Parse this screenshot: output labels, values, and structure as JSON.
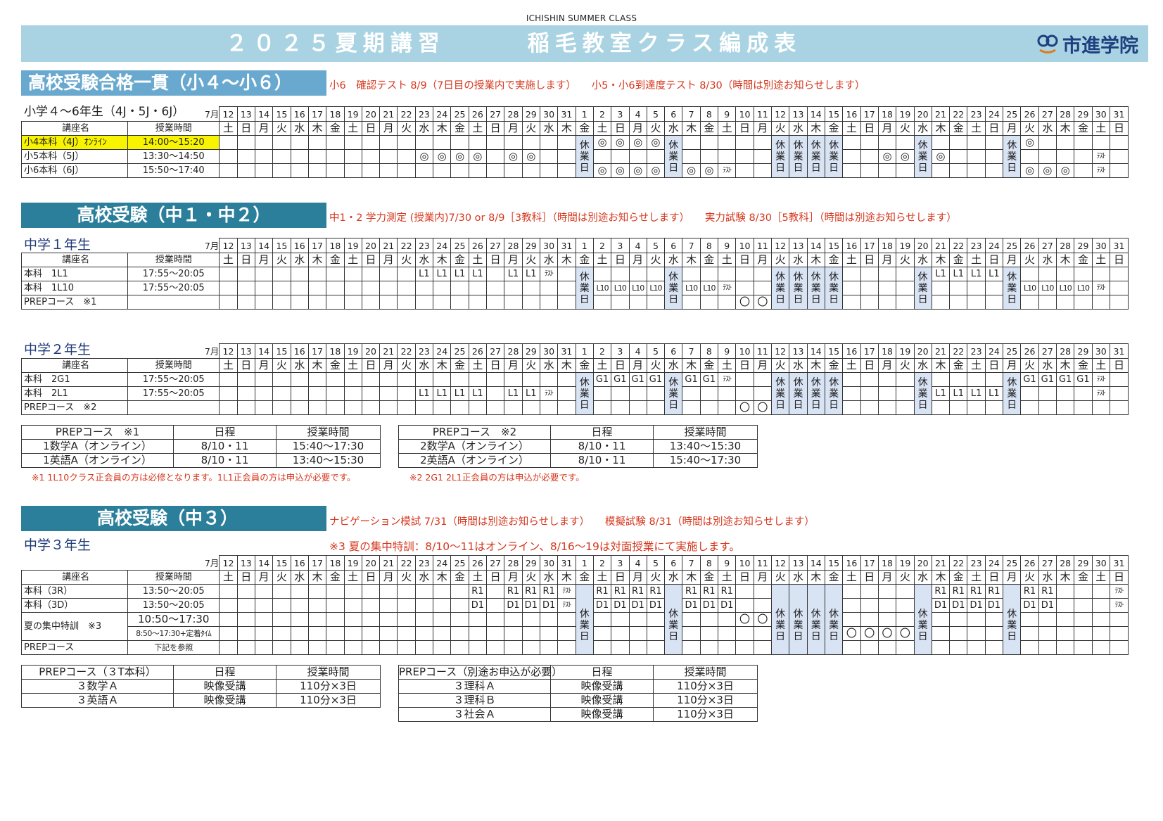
{
  "header": {
    "subtitle": "ICHISHIN SUMMER CLASS",
    "title": "２０２５夏期講習　　　稲毛教室クラス編成表",
    "logo_text": "市進学院",
    "banner_color": "#a9d3e2"
  },
  "colors": {
    "heading": "#2b7f9a",
    "heading_light": "#6aa9cf",
    "note": "#d5371e",
    "holiday": "#d8e3f4",
    "highlight": "#f8f400"
  },
  "calendar": {
    "month_label": "7月",
    "days": [
      "12",
      "13",
      "14",
      "15",
      "16",
      "17",
      "18",
      "19",
      "20",
      "21",
      "22",
      "23",
      "24",
      "25",
      "26",
      "27",
      "28",
      "29",
      "30",
      "31",
      "1",
      "2",
      "3",
      "4",
      "5",
      "6",
      "7",
      "8",
      "9",
      "10",
      "11",
      "12",
      "13",
      "14",
      "15",
      "16",
      "17",
      "18",
      "19",
      "20",
      "21",
      "22",
      "23",
      "24",
      "25",
      "26",
      "27",
      "28",
      "29",
      "30",
      "31"
    ],
    "weekdays": [
      "土",
      "日",
      "月",
      "火",
      "水",
      "木",
      "金",
      "土",
      "日",
      "月",
      "火",
      "水",
      "木",
      "金",
      "土",
      "日",
      "月",
      "火",
      "水",
      "木",
      "金",
      "土",
      "日",
      "月",
      "火",
      "水",
      "木",
      "金",
      "土",
      "日",
      "月",
      "火",
      "水",
      "木",
      "金",
      "土",
      "日",
      "月",
      "火",
      "水",
      "木",
      "金",
      "土",
      "日",
      "月",
      "火",
      "水",
      "木",
      "金",
      "土",
      "日"
    ],
    "holiday_text": "休業日"
  },
  "s1": {
    "heading": "高校受験合格一貫（小４～小６）",
    "note": "小6　確認テスト 8/9（7日目の授業内で実施します）　　小5・小6到達度テスト 8/30（時間は別途お知らせします）",
    "sub": "小学４～6年生（4J・5J・6J）",
    "col_name": "講座名",
    "col_time": "授業時間",
    "holidays": [
      20,
      25
    ],
    "rows": [
      {
        "name": "小4本科（4J）ｵﾝﾗｲﾝ",
        "time": "14:00～15:20",
        "highlight": true,
        "cells": {
          "21": "◎",
          "22": "◎",
          "23": "◎",
          "24": "◎",
          "44": "◎",
          "45": "◎"
        }
      },
      {
        "name": "小5本科（5J）",
        "time": "13:30～14:50",
        "cells": {
          "11": "◎",
          "12": "◎",
          "13": "◎",
          "14": "◎",
          "16": "◎",
          "17": "◎",
          "37": "◎",
          "38": "◎",
          "39": "◎",
          "40": "◎",
          "49": "ﾃｽﾄ"
        }
      },
      {
        "name": "小6本科（6J）",
        "time": "15:50～17:40",
        "cells": {
          "21": "◎",
          "22": "◎",
          "23": "◎",
          "24": "◎",
          "26": "◎",
          "27": "◎",
          "28": "ﾃｽﾄ",
          "44": "◎",
          "45": "◎",
          "46": "◎",
          "47": "◎",
          "49": "ﾃｽﾄ"
        }
      }
    ],
    "holidays_8": [
      31,
      32,
      33,
      34,
      36
    ]
  },
  "s2": {
    "heading": "高校受験（中１・中２）",
    "note": "中1・2 学力測定 (授業内)7/30 or 8/9［3教科］（時間は別途お知らせします）　　実力試験 8/30［5教科］（時間は別途お知らせします）",
    "sub1": "中学１年生",
    "sub2": "中学２年生",
    "col_name": "講座名",
    "col_time": "授業時間",
    "holidays": [
      20,
      25,
      31,
      32,
      33,
      34,
      39,
      44
    ],
    "g1_rows": [
      {
        "name": "本科　1L1",
        "time": "17:55～20:05",
        "cells": {
          "11": "L1",
          "12": "L1",
          "13": "L1",
          "14": "L1",
          "16": "L1",
          "17": "L1",
          "18": "ﾃｽﾄ",
          "40": "L1",
          "41": "L1",
          "42": "L1",
          "43": "L1"
        }
      },
      {
        "name": "本科　1L10",
        "time": "17:55～20:05",
        "cells": {
          "21": "L10",
          "22": "L10",
          "23": "L10",
          "24": "L10",
          "26": "L10",
          "27": "L10",
          "28": "ﾃｽﾄ",
          "45": "L10",
          "46": "L10",
          "47": "L10",
          "48": "L10",
          "49": "ﾃｽﾄ"
        }
      },
      {
        "name": "PREPコース　※1",
        "time": "",
        "cells": {
          "29": "〇",
          "30": "〇"
        }
      }
    ],
    "g2_rows": [
      {
        "name": "本科　2G1",
        "time": "17:55～20:05",
        "cells": {
          "21": "G1",
          "22": "G1",
          "23": "G1",
          "24": "G1",
          "26": "G1",
          "27": "G1",
          "28": "ﾃｽﾄ",
          "45": "G1",
          "46": "G1",
          "47": "G1",
          "48": "G1",
          "49": "ﾃｽﾄ"
        }
      },
      {
        "name": "本科　2L1",
        "time": "17:55～20:05",
        "cells": {
          "11": "L1",
          "12": "L1",
          "13": "L1",
          "14": "L1",
          "16": "L1",
          "17": "L1",
          "18": "ﾃｽﾄ",
          "40": "L1",
          "41": "L1",
          "42": "L1",
          "43": "L1",
          "49": "ﾃｽﾄ"
        }
      },
      {
        "name": "PREPコース　※2",
        "time": "",
        "cells": {
          "29": "〇",
          "30": "〇"
        }
      }
    ],
    "prep1": {
      "headers": [
        "PREPコース　※1",
        "日程",
        "授業時間"
      ],
      "rows": [
        [
          "1数学A（オンライン）",
          "8/10・11",
          "15:40～17:30"
        ],
        [
          "1英語A（オンライン）",
          "8/10・11",
          "13:40～15:30"
        ]
      ],
      "foot": "※1 1L10クラス正会員の方は必修となります。1L1正会員の方は申込が必要です。"
    },
    "prep2": {
      "headers": [
        "PREPコース　※2",
        "日程",
        "授業時間"
      ],
      "rows": [
        [
          "2数学A（オンライン）",
          "8/10・11",
          "13:40～15:30"
        ],
        [
          "2英語A（オンライン）",
          "8/10・11",
          "15:40～17:30"
        ]
      ],
      "foot": "※2 2G1 2L1正会員の方は申込が必要です。"
    }
  },
  "s3": {
    "heading": "高校受験（中３）",
    "note": "ナビゲーション模試 7/31（時間は別途お知らせします）　　模擬試験 8/31（時間は別途お知らせします）",
    "note2": "※3 夏の集中特訓：8/10～11はオンライン、8/16～19は対面授業にて実施します。",
    "sub": "中学３年生",
    "col_name": "講座名",
    "col_time": "授業時間",
    "holidays": [
      20,
      25,
      31,
      32,
      33,
      34,
      39,
      44
    ],
    "rows": [
      {
        "name": "本科（3R）",
        "time": "13:50～20:05",
        "cells": {
          "14": "R1",
          "16": "R1",
          "17": "R1",
          "18": "R1",
          "19": "ﾃｽﾄ",
          "21": "R1",
          "22": "R1",
          "23": "R1",
          "24": "R1",
          "26": "R1",
          "27": "R1",
          "28": "R1",
          "40": "R1",
          "41": "R1",
          "42": "R1",
          "43": "R1",
          "45": "R1",
          "46": "R1",
          "50": "ﾃｽﾄ"
        }
      },
      {
        "name": "本科（3D）",
        "time": "13:50～20:05",
        "cells": {
          "14": "D1",
          "16": "D1",
          "17": "D1",
          "18": "D1",
          "19": "ﾃｽﾄ",
          "21": "D1",
          "22": "D1",
          "23": "D1",
          "24": "D1",
          "26": "D1",
          "27": "D1",
          "28": "D1",
          "40": "D1",
          "41": "D1",
          "42": "D1",
          "43": "D1",
          "45": "D1",
          "46": "D1",
          "50": "ﾃｽﾄ"
        }
      }
    ],
    "intensive": {
      "name": "夏の集中特訓　※3",
      "time1": "10:50～17:30",
      "time2": "8:50～17:30+定着ﾀｲﾑ",
      "row1": {
        "29": "〇",
        "30": "〇"
      },
      "row2": {
        "35": "〇",
        "36": "〇",
        "37": "〇",
        "38": "〇"
      }
    },
    "prep_row": {
      "name": "PREPコース",
      "time": "下記を参照"
    },
    "prep1": {
      "headers": [
        "PREPコース（３T本科）",
        "日程",
        "授業時間"
      ],
      "rows": [
        [
          "３数学Ａ",
          "映像受講",
          "110分×3日"
        ],
        [
          "３英語Ａ",
          "映像受講",
          "110分×3日"
        ]
      ]
    },
    "prep2": {
      "headers": [
        "PREPコース（別途お申込が必要）",
        "日程",
        "授業時間"
      ],
      "rows": [
        [
          "３理科Ａ",
          "映像受講",
          "110分×3日"
        ],
        [
          "３理科Ｂ",
          "映像受講",
          "110分×3日"
        ],
        [
          "３社会Ａ",
          "映像受講",
          "110分×3日"
        ]
      ]
    }
  }
}
